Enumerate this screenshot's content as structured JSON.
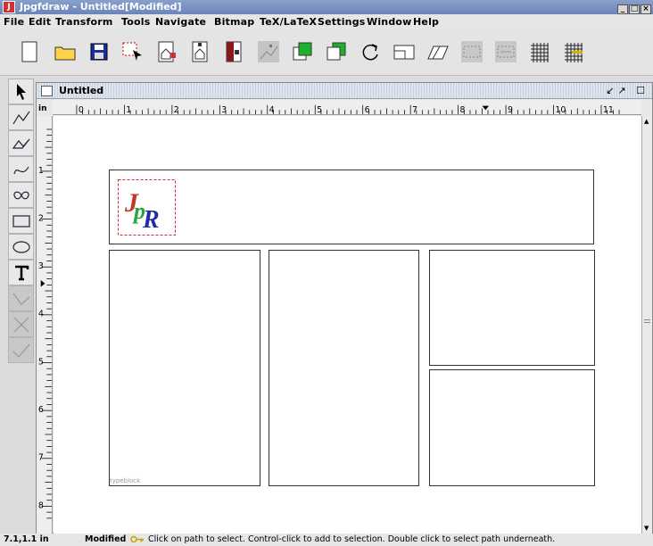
{
  "window": {
    "title": "Jpgfdraw - Untitled[Modified]",
    "controls": [
      "_",
      "□",
      "×"
    ]
  },
  "menu": [
    "File",
    "Edit",
    "Transform",
    "Tools",
    "Navigate",
    "Bitmap",
    "TeX/LaTeX",
    "Settings",
    "Window",
    "Help"
  ],
  "toolbar": {
    "buttons": [
      "new-icon",
      "open-icon",
      "save-icon",
      "select-icon",
      "insert-bitmap-icon",
      "properties-icon",
      "refresh-bitmap-icon",
      "edit-path-icon",
      "move-to-front-icon",
      "move-to-back-icon",
      "rotate-icon",
      "scale-icon",
      "shear-icon",
      "show-grid-icon",
      "grid-lock-icon",
      "rectangular-grid-icon",
      "radial-grid-icon"
    ]
  },
  "tools": [
    "select-icon",
    "open-line-icon",
    "closed-line-icon",
    "open-curve-icon",
    "closed-curve-icon",
    "rectangle-icon",
    "ellipse-icon",
    "text-icon",
    "disabled-line-icon",
    "disabled-cross-icon",
    "disabled-check-icon"
  ],
  "document": {
    "title": "Untitled",
    "ruler_unit": "in",
    "h_ticks": [
      "0",
      "1",
      "2",
      "3",
      "4",
      "5",
      "6",
      "7",
      "8",
      "9",
      "10",
      "11"
    ],
    "v_ticks": [
      "1",
      "2",
      "3",
      "4",
      "5",
      "6",
      "7",
      "8"
    ],
    "typeblock_label": "typeblock",
    "logo_text": "JpR"
  },
  "status": {
    "coordinate": "7.1,1.1 in",
    "modified": "Modified",
    "message": "Click on path to select. Control-click to add to selection. Double click to select path underneath."
  }
}
